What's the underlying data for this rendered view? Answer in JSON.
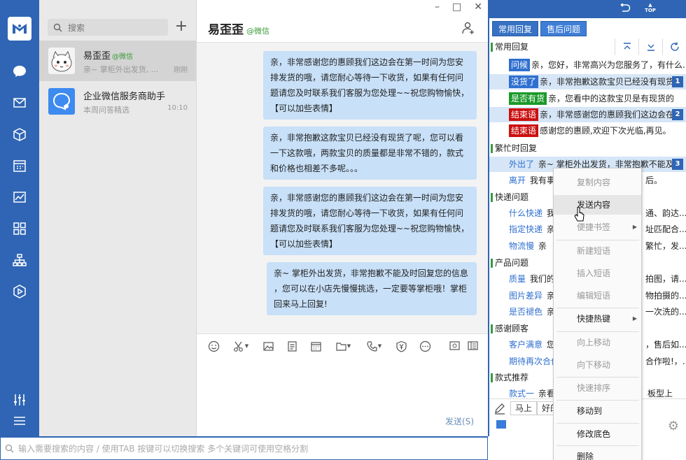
{
  "search": {
    "placeholder": "搜索"
  },
  "contacts": [
    {
      "name": "易歪歪",
      "tag": "@微信",
      "preview": "亲~ 掌柜外出发货, ...",
      "time": "刚刚"
    },
    {
      "name": "企业微信服务商助手",
      "preview": "本周问答精选",
      "time": "10:10"
    }
  ],
  "chat": {
    "title": "易歪歪",
    "subtitle": "@微信",
    "messages": [
      "亲，非常感谢您的惠顾我们这边会在第一时间为您安\n排发货的哦，请您耐心等待一下收货，如果有任何问\n题请您及时联系我们客服为您处理~~祝您购物愉快，\n【可以加些表情】",
      "亲，非常抱歉这款宝贝已经没有现货了呢，您可以看\n一下这款哦，两款宝贝的质量都是非常不错的，款式\n和价格也相差不多呢。。。",
      "亲，非常感谢您的惠顾我们这边会在第一时间为您安\n排发货的哦，请您耐心等待一下收货，如果有任何问\n题请您及时联系我们客服为您处理~~祝您购物愉快，\n【可以加些表情】",
      "亲~ 掌柜外出发货，非常抱歉不能及时回复您的信息\n，您可以在小店先慢慢挑选，一定要等掌柜哦！掌柜\n回来马上回复!"
    ],
    "send_label": "发送(S)"
  },
  "bottom_search": {
    "placeholder": "输入需要搜索的内容 / 使用TAB 按键可以切换搜索 多个关键词可使用空格分割"
  },
  "panel": {
    "top_label": "TOP",
    "tabs": [
      "常用回复",
      "售后问题"
    ],
    "groups": {
      "g1": "常用回复",
      "g2": "繁忙时回复",
      "g3": "快递问题",
      "g4": "产品问题",
      "g5": "感谢顾客",
      "g6": "款式推荐"
    },
    "rows": [
      {
        "tag": "问候",
        "text": "亲，您好，非常高兴为您服务了，有什么..."
      },
      {
        "tag": "没货了",
        "text": "亲，非常抱歉这款宝贝已经没有现货了",
        "num": "1"
      },
      {
        "tag": "是否有货",
        "text": "亲，您看中的这款宝贝是有现货的"
      },
      {
        "tag": "结束语",
        "text": "亲，非常感谢您的惠顾我们这边会在第",
        "num": "2"
      },
      {
        "tag": "结束语",
        "text": "感谢您的惠顾,欢迎下次光临,再见。"
      },
      {
        "tag": "外出了",
        "text": "亲~ 掌柜外出发货，非常抱歉不能及时",
        "num": "3"
      },
      {
        "tag": "离开",
        "text": "我有事"
      },
      {
        "tag": "什么快递",
        "text": "我"
      },
      {
        "tag": "指定快递",
        "text": "亲"
      },
      {
        "tag": "物流慢",
        "text": "亲"
      },
      {
        "tag": "质量",
        "text": "我们的"
      },
      {
        "tag": "图片差异",
        "text": "亲"
      },
      {
        "tag": "是否褪色",
        "text": "亲"
      },
      {
        "tag": "客户满意",
        "text": "您"
      },
      {
        "tag": "期待再次合作",
        "text": ""
      },
      {
        "tag": "款式一",
        "text": "亲看"
      }
    ],
    "row_tails": {
      "r7": "后。",
      "r8": "通、韵达...",
      "r9": "址匹配合...",
      "r10": "繁忙，发...",
      "r11": "拍图，请...",
      "r12": "物拍摄的...",
      "r13": "一次洗的...",
      "r14": "，售后如...",
      "r15": "合作啦!，...",
      "r16": "板型上"
    },
    "bottom_buttons": [
      "马上",
      "好的"
    ]
  },
  "menu": {
    "items": [
      {
        "label": "复制内容",
        "disabled": true
      },
      {
        "label": "发送内容",
        "disabled": false
      },
      {
        "label": "便捷书签",
        "disabled": true,
        "submenu": true
      },
      {
        "label": "新建短语",
        "disabled": true
      },
      {
        "label": "插入短语",
        "disabled": true
      },
      {
        "label": "编辑短语",
        "disabled": true
      },
      {
        "label": "快捷热键",
        "disabled": false,
        "submenu": true
      },
      {
        "label": "向上移动",
        "disabled": true
      },
      {
        "label": "向下移动",
        "disabled": true
      },
      {
        "label": "快速排序",
        "disabled": true
      },
      {
        "label": "移动到",
        "disabled": false
      },
      {
        "label": "修改底色",
        "disabled": false
      },
      {
        "label": "删除",
        "disabled": false
      }
    ]
  },
  "colors": {
    "accent": "#2f65b4",
    "bubble": "#c8e0f8",
    "tag_blue": "#2f6fd0",
    "tag_green": "#1a9a2a",
    "tag_red": "#cc1010"
  }
}
